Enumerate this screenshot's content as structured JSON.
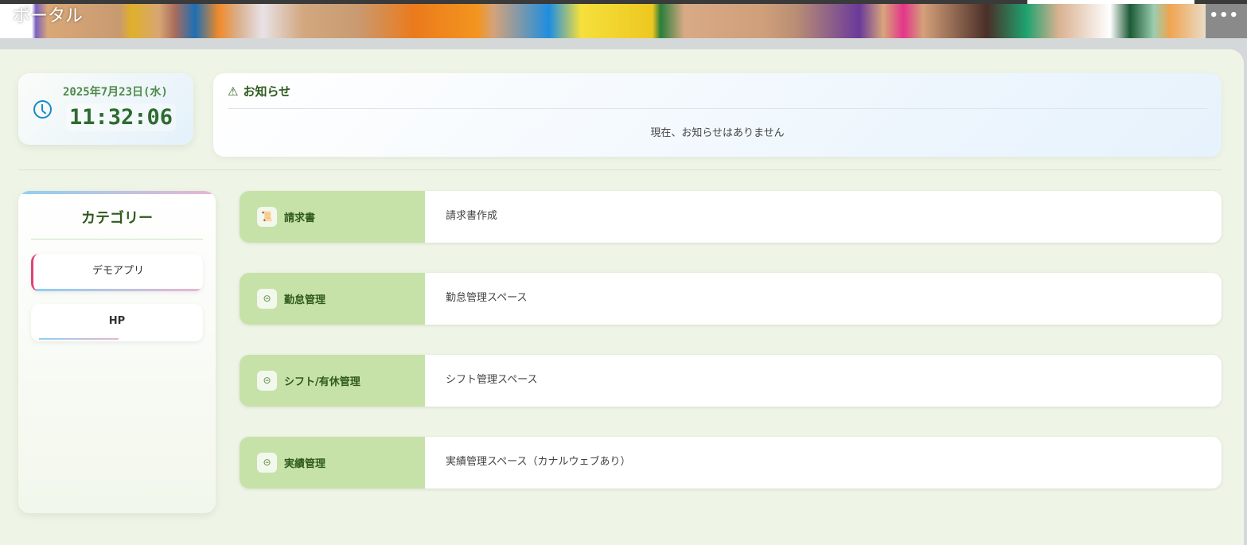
{
  "header": {
    "title": "ポータル",
    "more_label": "•••"
  },
  "clock": {
    "date": "2025年7月23日(水)",
    "time": "11:32:06"
  },
  "notice": {
    "title": "お知らせ",
    "icon": "warning-icon",
    "body": "現在、お知らせはありません"
  },
  "categories": {
    "title": "カテゴリー",
    "items": [
      {
        "label": "デモアプリ",
        "active": true
      },
      {
        "label": "HP",
        "active": false
      }
    ]
  },
  "apps": [
    {
      "label": "請求書",
      "icon": "scroll-icon",
      "description": "請求書作成"
    },
    {
      "label": "勤怠管理",
      "icon": "arrow-circle-icon",
      "description": "勤怠管理スペース"
    },
    {
      "label": "シフト/有休管理",
      "icon": "arrow-circle-icon",
      "description": "シフト管理スペース"
    },
    {
      "label": "実績管理",
      "icon": "arrow-circle-icon",
      "description": "実績管理スペース（カナルウェブあり）"
    }
  ]
}
